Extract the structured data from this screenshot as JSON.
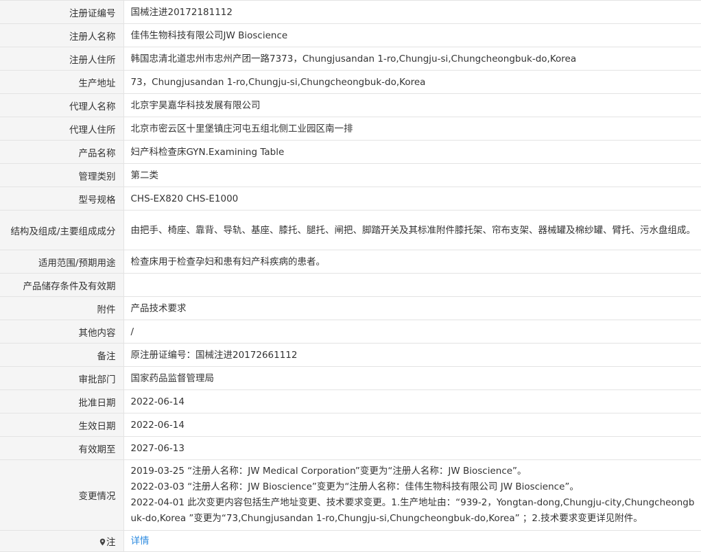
{
  "rows": [
    {
      "label": "注册证编号",
      "value": "国械注进20172181112"
    },
    {
      "label": "注册人名称",
      "value": "佳伟生物科技有限公司JW Bioscience"
    },
    {
      "label": "注册人住所",
      "value": "韩国忠清北道忠州市忠州产团一路7373，Chungjusandan 1-ro,Chungju-si,Chungcheongbuk-do,Korea"
    },
    {
      "label": "生产地址",
      "value": "73，Chungjusandan 1-ro,Chungju-si,Chungcheongbuk-do,Korea"
    },
    {
      "label": "代理人名称",
      "value": "北京宇昊嘉华科技发展有限公司"
    },
    {
      "label": "代理人住所",
      "value": "北京市密云区十里堡镇庄河屯五组北侧工业园区南一排"
    },
    {
      "label": "产品名称",
      "value": "妇产科检查床GYN.Examining Table"
    },
    {
      "label": "管理类别",
      "value": "第二类"
    },
    {
      "label": "型号规格",
      "value": "CHS-EX820 CHS-E1000"
    },
    {
      "label": "结构及组成/主要组成成分",
      "value": "由把手、椅座、靠背、导轨、基座、膝托、腿托、闸把、脚踏开关及其标准附件膝托架、帘布支架、器械罐及棉纱罐、臂托、污水盘组成。"
    },
    {
      "label": "适用范围/预期用途",
      "value": "检查床用于检查孕妇和患有妇产科疾病的患者。"
    },
    {
      "label": "产品储存条件及有效期",
      "value": ""
    },
    {
      "label": "附件",
      "value": "产品技术要求"
    },
    {
      "label": "其他内容",
      "value": "/"
    },
    {
      "label": "备注",
      "value": "原注册证编号：国械注进20172661112"
    },
    {
      "label": "审批部门",
      "value": "国家药品监督管理局"
    },
    {
      "label": "批准日期",
      "value": "2022-06-14"
    },
    {
      "label": "生效日期",
      "value": "2022-06-14"
    },
    {
      "label": "有效期至",
      "value": "2027-06-13"
    }
  ],
  "change": {
    "label": "变更情况",
    "lines": [
      "2019-03-25 “注册人名称：JW Medical Corporation”变更为“注册人名称：JW Bioscience”。",
      "2022-03-03 “注册人名称：JW Bioscience”变更为“注册人名称：佳伟生物科技有限公司 JW Bioscience”。",
      "2022-04-01 此次变更内容包括生产地址变更、技术要求变更。1.生产地址由：“939-2，Yongtan-dong,Chungju-city,Chungcheongbuk-do,Korea ”变更为“73,Chungjusandan 1-ro,Chungju-si,Chungcheongbuk-do,Korea” ；2.技术要求变更详见附件。"
    ]
  },
  "note": {
    "label": "注",
    "icon": "pin-icon",
    "link_text": "详情",
    "link_color": "#2f8ce0"
  }
}
